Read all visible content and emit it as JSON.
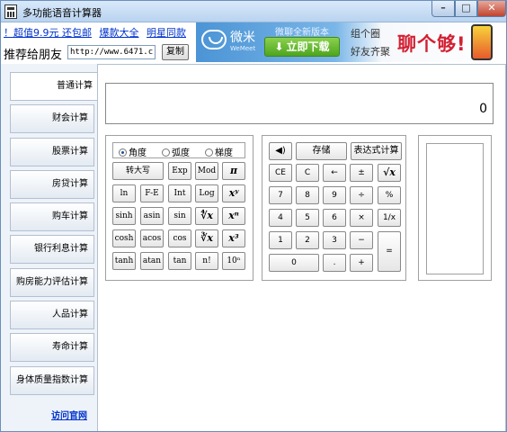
{
  "window": {
    "title": "多功能语音计算器",
    "min": "–",
    "max": "□",
    "close": "✕"
  },
  "top": {
    "links": [
      "！超值9.9元 还包邮",
      "爆款大全",
      "明星同款"
    ],
    "share_label": "推荐给朋友",
    "share_url": "http://www.6471.c",
    "copy_label": "复制"
  },
  "ad": {
    "brand": "微米",
    "brand_sub": "WeMeet",
    "slogan": "微聊全新版本",
    "download": "立即下载",
    "text1": "组个圈",
    "text2": "好友齐聚",
    "big": "聊个够!"
  },
  "sidebar": {
    "items": [
      "普通计算",
      "财会计算",
      "股票计算",
      "房贷计算",
      "购车计算",
      "银行利息计算",
      "购房能力评估计算",
      "人品计算",
      "寿命计算",
      "身体质量指数计算"
    ],
    "link": "访问官网"
  },
  "display": {
    "value": "0"
  },
  "mode": {
    "options": [
      "角度",
      "弧度",
      "梯度"
    ],
    "selected": "角度"
  },
  "sci_keys": [
    [
      "转大写",
      "Exp",
      "Mod",
      "π"
    ],
    [
      "ln",
      "F-E",
      "Int",
      "Log",
      "xʸ"
    ],
    [
      "sinh",
      "asin",
      "sin",
      "∜x",
      "xⁿ"
    ],
    [
      "cosh",
      "acos",
      "cos",
      "∛x",
      "x³"
    ],
    [
      "tanh",
      "atan",
      "tan",
      "n!",
      "10ⁿ"
    ]
  ],
  "std_top": {
    "sound": "◀)",
    "store": "存储",
    "expr": "表达式计算"
  },
  "std_keys": [
    [
      "CE",
      "C",
      "←",
      "±",
      "√x"
    ],
    [
      "7",
      "8",
      "9",
      "÷",
      "%"
    ],
    [
      "4",
      "5",
      "6",
      "×",
      "1/x"
    ],
    [
      "1",
      "2",
      "3",
      "−",
      "="
    ],
    [
      "0",
      ".",
      "+"
    ]
  ]
}
